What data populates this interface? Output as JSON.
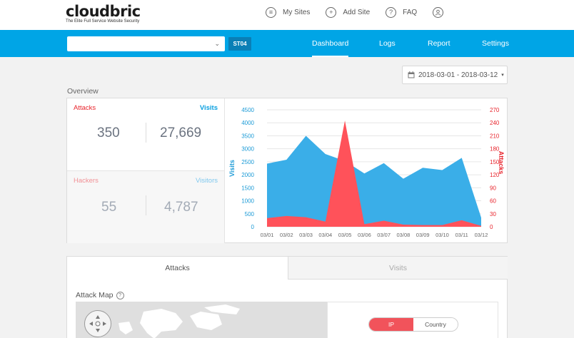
{
  "logo": {
    "word": "cloudbric",
    "tagline": "The Elite Full Service Website Security"
  },
  "top_links": [
    {
      "label": "My Sites",
      "icon": "list-icon"
    },
    {
      "label": "Add Site",
      "icon": "plus-icon"
    },
    {
      "label": "FAQ",
      "icon": "question-icon"
    },
    {
      "label": "",
      "icon": "user-icon"
    }
  ],
  "nav": {
    "site_select_value": "",
    "site_button": "ST04",
    "tabs": [
      "Dashboard",
      "Logs",
      "Report",
      "Settings"
    ],
    "active_tab": "Dashboard"
  },
  "date_range": "2018-03-01 - 2018-03-12",
  "overview": {
    "title": "Overview",
    "attacks_label": "Attacks",
    "visits_label": "Visits",
    "attacks_value": "350",
    "visits_value": "27,669",
    "hackers_label": "Hackers",
    "visitors_label": "Visitors",
    "hackers_value": "55",
    "visitors_value": "4,787"
  },
  "colors": {
    "brand_blue": "#00a5e6",
    "visits": "#3aaee8",
    "attacks": "#ff525a",
    "attacks_label": "#e8242c",
    "hackers_label": "#f19095",
    "visitors_label": "#7fc8ee"
  },
  "chart_data": {
    "type": "area",
    "categories": [
      "03/01",
      "03/02",
      "03/03",
      "03/04",
      "03/05",
      "03/06",
      "03/07",
      "03/08",
      "03/09",
      "03/10",
      "03/11",
      "03/12"
    ],
    "series": [
      {
        "name": "Visits",
        "axis": "left",
        "values": [
          2430,
          2580,
          3500,
          2800,
          2530,
          2050,
          2450,
          1850,
          2270,
          2180,
          2650,
          350
        ]
      },
      {
        "name": "Attacks",
        "axis": "right",
        "values": [
          20,
          25,
          22,
          12,
          245,
          6,
          14,
          5,
          4,
          4,
          15,
          2
        ]
      }
    ],
    "ylabel": "Visits",
    "y2label": "Attacks",
    "ylim": [
      0,
      4500
    ],
    "y2lim": [
      0,
      270
    ],
    "yticks": [
      0,
      500,
      1000,
      1500,
      2000,
      2500,
      3000,
      3500,
      4000,
      4500
    ],
    "y2ticks": [
      0,
      30,
      60,
      90,
      120,
      150,
      180,
      210,
      240,
      270
    ],
    "grid": true
  },
  "tabs": {
    "items": [
      "Attacks",
      "Visits"
    ],
    "active": "Attacks"
  },
  "attack_map": {
    "title": "Attack Map",
    "toggle": [
      "IP",
      "Country"
    ],
    "toggle_active": "IP"
  }
}
